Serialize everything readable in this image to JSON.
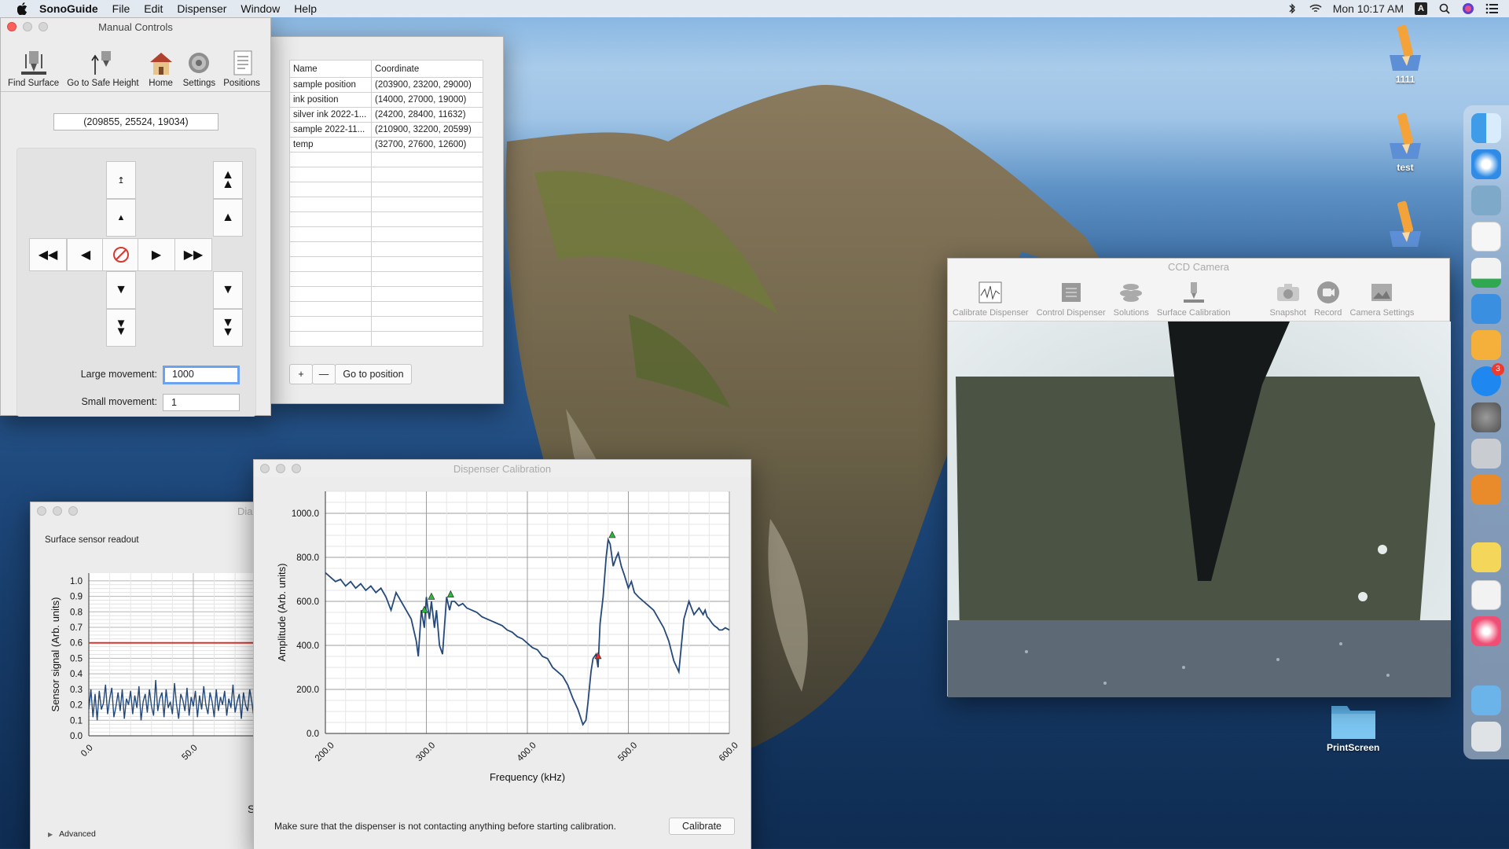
{
  "menubar": {
    "app_name": "SonoGuide",
    "menus": [
      "File",
      "Edit",
      "Dispenser",
      "Window",
      "Help"
    ],
    "clock": "Mon 10:17 AM",
    "input_badge": "A"
  },
  "desktop": {
    "icons": [
      {
        "label": "1111"
      },
      {
        "label": "test"
      },
      {
        "label": ""
      },
      {
        "label": "PrintScreen"
      }
    ]
  },
  "dock": {
    "app_store_badge": "3"
  },
  "manual_controls": {
    "title": "Manual Controls",
    "toolbar": [
      "Find Surface",
      "Go to Safe Height",
      "Home",
      "Settings",
      "Positions"
    ],
    "current_coordinate": "(209855, 25524, 19034)",
    "large_movement_label": "Large movement:",
    "large_movement_value": "1000",
    "small_movement_label": "Small movement:",
    "small_movement_value": "1"
  },
  "positions": {
    "headers": [
      "Name",
      "Coordinate"
    ],
    "rows": [
      [
        "sample position",
        "(203900, 23200, 29000)"
      ],
      [
        "ink position",
        "(14000, 27000, 19000)"
      ],
      [
        "silver ink 2022-1...",
        "(24200, 28400, 11632)"
      ],
      [
        "sample 2022-11...",
        "(210900, 32200, 20599)"
      ],
      [
        "temp",
        "(32700, 27600, 12600)"
      ]
    ],
    "add_label": "+",
    "remove_label": "—",
    "go_label": "Go to position"
  },
  "diag": {
    "title": "Dia",
    "section_label": "Surface sensor readout",
    "advanced_label": "Advanced",
    "cut_label": "S",
    "threshold_color": "#e0302a"
  },
  "calibration": {
    "title": "Dispenser Calibration",
    "note": "Make sure that the dispenser is not contacting anything before starting calibration.",
    "calibrate_label": "Calibrate"
  },
  "camera": {
    "title": "CCD Camera",
    "tools": [
      "Calibrate Dispenser",
      "Control Dispenser",
      "Solutions",
      "Surface Calibration",
      "Snapshot",
      "Record",
      "Camera Settings"
    ]
  },
  "chart_data": [
    {
      "type": "line",
      "xlabel": "",
      "ylabel": "Sensor signal (Arb. units)",
      "xticks": [
        "0.0",
        "50.0"
      ],
      "yticks": [
        "0.0",
        "0.1",
        "0.2",
        "0.3",
        "0.4",
        "0.5",
        "0.6",
        "0.7",
        "0.8",
        "0.9",
        "1.0"
      ],
      "xlim": [
        0,
        85
      ],
      "ylim": [
        0,
        1.05
      ],
      "threshold": 0.6,
      "series": [
        {
          "x": [
            0,
            1,
            2,
            3,
            4,
            5,
            6,
            7,
            8,
            9,
            10,
            11,
            12,
            13,
            14,
            15,
            16,
            17,
            18,
            19,
            20,
            21,
            22,
            23,
            24,
            25,
            26,
            27,
            28,
            29,
            30,
            31,
            32,
            33,
            34,
            35,
            36,
            37,
            38,
            39,
            40,
            41,
            42,
            43,
            44,
            45,
            46,
            47,
            48,
            49,
            50,
            51,
            52,
            53,
            54,
            55,
            56,
            57,
            58,
            59,
            60,
            61,
            62,
            63,
            64,
            65,
            66,
            67,
            68,
            69,
            70,
            71,
            72,
            73,
            74,
            75,
            76,
            77,
            78,
            79,
            80,
            81,
            82,
            83,
            84
          ],
          "values": [
            0.17,
            0.3,
            0.12,
            0.27,
            0.1,
            0.29,
            0.17,
            0.21,
            0.33,
            0.14,
            0.24,
            0.31,
            0.12,
            0.19,
            0.28,
            0.16,
            0.3,
            0.11,
            0.24,
            0.2,
            0.29,
            0.14,
            0.26,
            0.18,
            0.32,
            0.1,
            0.22,
            0.27,
            0.15,
            0.3,
            0.19,
            0.13,
            0.36,
            0.16,
            0.24,
            0.28,
            0.12,
            0.3,
            0.18,
            0.22,
            0.14,
            0.34,
            0.2,
            0.11,
            0.27,
            0.23,
            0.16,
            0.31,
            0.13,
            0.25,
            0.19,
            0.29,
            0.12,
            0.26,
            0.17,
            0.32,
            0.2,
            0.14,
            0.28,
            0.22,
            0.12,
            0.3,
            0.16,
            0.25,
            0.2,
            0.29,
            0.13,
            0.24,
            0.18,
            0.33,
            0.15,
            0.22,
            0.27,
            0.11,
            0.28,
            0.2,
            0.16,
            0.3,
            0.22,
            0.12,
            0.26,
            0.18,
            0.29,
            0.16,
            0.24
          ]
        }
      ]
    },
    {
      "type": "line",
      "xlabel": "Frequency (kHz)",
      "ylabel": "Amplitude (Arb. units)",
      "xticks": [
        "200.0",
        "300.0",
        "400.0",
        "500.0",
        "600.0"
      ],
      "yticks": [
        "0.0",
        "200.0",
        "400.0",
        "600.0",
        "800.0",
        "1000.0"
      ],
      "xlim": [
        200,
        600
      ],
      "ylim": [
        0,
        1100
      ],
      "series": [
        {
          "x": [
            200,
            205,
            210,
            215,
            220,
            225,
            230,
            235,
            240,
            245,
            250,
            255,
            260,
            265,
            270,
            275,
            280,
            285,
            290,
            292,
            295,
            298,
            300,
            303,
            305,
            308,
            310,
            313,
            316,
            320,
            323,
            325,
            328,
            332,
            336,
            340,
            345,
            350,
            355,
            360,
            365,
            370,
            375,
            380,
            385,
            390,
            395,
            400,
            405,
            410,
            415,
            420,
            425,
            430,
            435,
            440,
            445,
            450,
            455,
            458,
            460,
            463,
            465,
            468,
            470,
            472,
            475,
            478,
            480,
            482,
            485,
            488,
            490,
            493,
            496,
            500,
            503,
            506,
            510,
            515,
            520,
            525,
            530,
            535,
            540,
            545,
            550,
            555,
            560,
            565,
            570,
            574,
            576,
            578,
            580,
            583,
            585,
            588,
            590,
            593,
            596,
            600
          ],
          "values": [
            730,
            710,
            690,
            700,
            670,
            690,
            660,
            680,
            650,
            670,
            640,
            660,
            620,
            560,
            640,
            600,
            560,
            520,
            420,
            350,
            560,
            480,
            620,
            520,
            600,
            480,
            560,
            400,
            360,
            620,
            560,
            600,
            600,
            580,
            590,
            570,
            560,
            550,
            530,
            520,
            510,
            500,
            490,
            470,
            460,
            440,
            430,
            410,
            390,
            380,
            350,
            340,
            300,
            280,
            260,
            220,
            160,
            110,
            40,
            60,
            140,
            280,
            340,
            360,
            300,
            500,
            620,
            800,
            880,
            860,
            760,
            800,
            820,
            760,
            720,
            660,
            690,
            640,
            620,
            600,
            580,
            560,
            520,
            480,
            420,
            330,
            280,
            520,
            600,
            540,
            570,
            540,
            560,
            530,
            520,
            500,
            490,
            480,
            470,
            470,
            480,
            470
          ]
        }
      ],
      "markers": [
        {
          "x": 298,
          "y": 560,
          "color": "#2db83d"
        },
        {
          "x": 305,
          "y": 620,
          "color": "#2db83d"
        },
        {
          "x": 324,
          "y": 630,
          "color": "#2db83d"
        },
        {
          "x": 470,
          "y": 350,
          "color": "#e0302a"
        },
        {
          "x": 484,
          "y": 900,
          "color": "#2db83d"
        }
      ],
      "line_color": "#24497a"
    }
  ]
}
